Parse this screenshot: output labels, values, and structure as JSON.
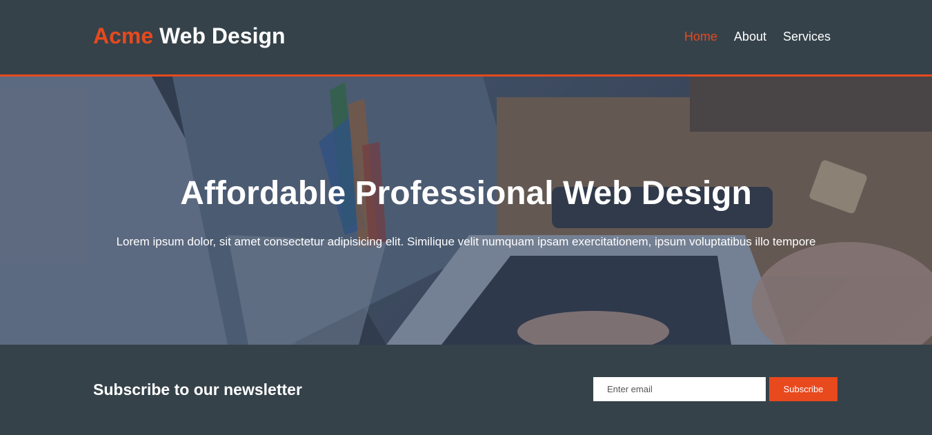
{
  "header": {
    "brand_highlight": "Acme",
    "brand_rest": " Web Design",
    "nav": [
      {
        "label": "Home",
        "active": true
      },
      {
        "label": "About",
        "active": false
      },
      {
        "label": "Services",
        "active": false
      }
    ]
  },
  "showcase": {
    "title": "Affordable Professional Web Design",
    "text": "Lorem ipsum dolor, sit amet consectetur adipisicing elit. Similique velit numquam ipsam exercitationem, ipsum voluptatibus illo tempore",
    "background_image": "laptop-workspace-photo"
  },
  "newsletter": {
    "title": "Subscribe to our newsletter",
    "email_placeholder": "Enter email",
    "email_value": "",
    "button_label": "Subscribe"
  },
  "colors": {
    "dark": "#35424a",
    "accent": "#e8491d",
    "text": "#ffffff"
  }
}
